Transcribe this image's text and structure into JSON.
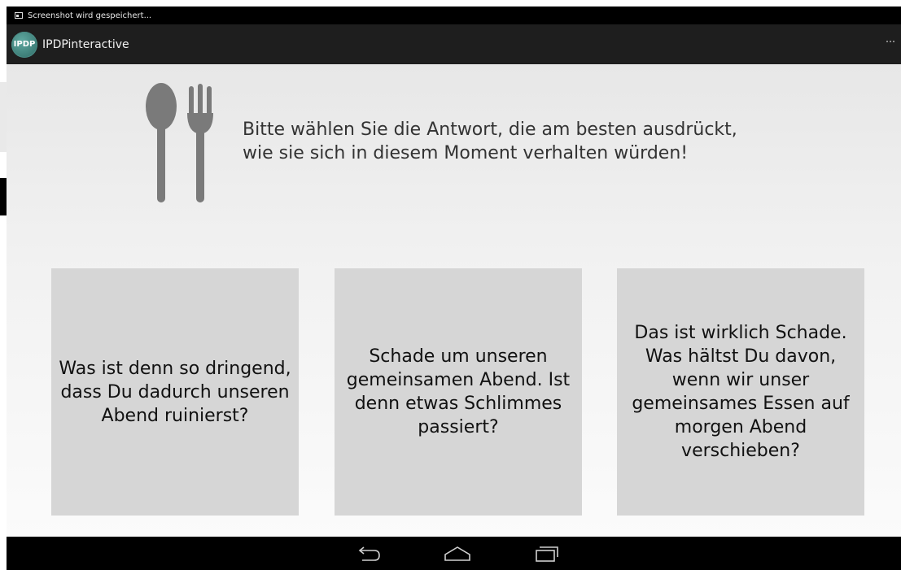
{
  "status_bar": {
    "notification": "Screenshot wird gespeichert..."
  },
  "action_bar": {
    "logo_text": "IPDP",
    "title": "IPDPinteractive"
  },
  "prompt": {
    "lines": [
      "Bitte wählen Sie die Antwort, die am besten ausdrückt,",
      "wie sie sich in diesem Moment verhalten würden!"
    ]
  },
  "icons": {
    "cutlery": "spoon-fork-icon",
    "back": "back-icon",
    "home": "home-icon",
    "recents": "recent-apps-icon"
  },
  "options": [
    {
      "lines": [
        "Was ist denn so dringend,",
        "dass Du dadurch unseren",
        "Abend ruinierst?"
      ]
    },
    {
      "lines": [
        "Schade um unseren",
        "gemeinsamen Abend. Ist",
        "denn etwas Schlimmes",
        "passiert?"
      ]
    },
    {
      "lines": [
        "Das ist wirklich Schade.",
        "Was hältst Du davon,",
        "wenn wir unser",
        "gemeinsames Essen auf",
        "morgen Abend",
        "verschieben?"
      ]
    }
  ],
  "colors": {
    "action_bar": "#1e1e1e",
    "card": "#d6d6d6",
    "icon_gray": "#7a7a7a",
    "logo": "#3f8a83"
  }
}
